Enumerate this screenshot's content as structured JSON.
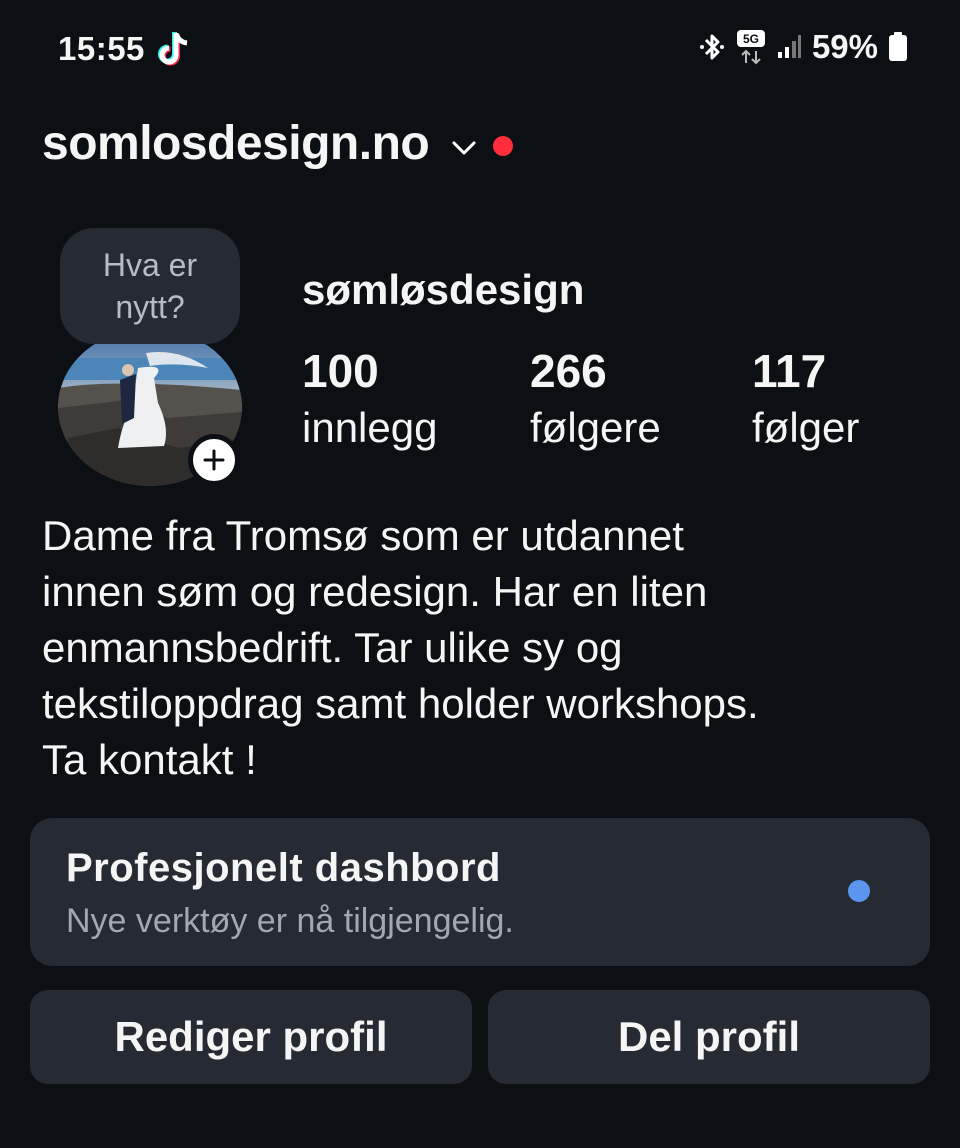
{
  "status_bar": {
    "time": "15:55",
    "battery": "59%",
    "icons": [
      "tiktok-icon",
      "bluetooth-icon",
      "5g-icon",
      "signal-icon",
      "battery-icon"
    ]
  },
  "header": {
    "account_name": "somlosdesign.no"
  },
  "note": {
    "line1": "Hva er",
    "line2": "nytt?"
  },
  "profile": {
    "display_name": "sømløsdesign",
    "stats": {
      "posts_value": "100",
      "posts_label": "innlegg",
      "followers_value": "266",
      "followers_label": "følgere",
      "following_value": "117",
      "following_label": "følger"
    },
    "bio_lines": [
      "Dame fra Tromsø som er utdannet",
      "innen søm og redesign. Har en liten",
      "enmannsbedrift. Tar ulike sy og",
      "tekstiloppdrag samt holder workshops.",
      "Ta kontakt !"
    ]
  },
  "dashboard": {
    "title": "Profesjonelt dashbord",
    "subtitle": "Nye verktøy er nå tilgjengelig."
  },
  "buttons": {
    "edit_profile": "Rediger profil",
    "share_profile": "Del profil"
  },
  "colors": {
    "background": "#0c0f14",
    "card": "#262b33",
    "notification_dot": "#ff2d3b",
    "dashboard_dot": "#5b95f0"
  }
}
